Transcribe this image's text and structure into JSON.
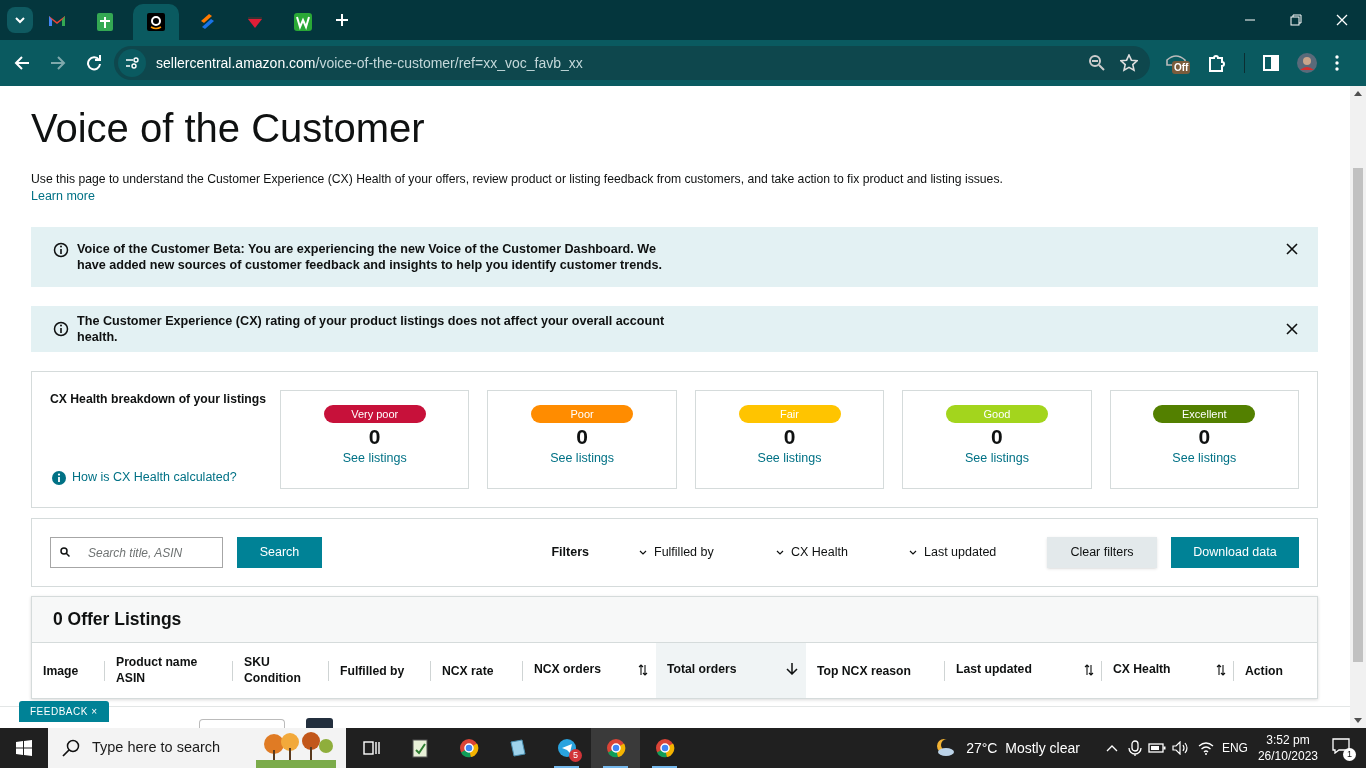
{
  "browser": {
    "tabs": [
      {
        "kind": "gmail",
        "selected": false
      },
      {
        "kind": "sheet",
        "selected": false
      },
      {
        "kind": "amazon",
        "selected": true
      },
      {
        "kind": "stripes",
        "selected": false
      },
      {
        "kind": "red",
        "selected": false
      },
      {
        "kind": "w",
        "selected": false
      }
    ],
    "address": {
      "host": "sellercentral.amazon.com",
      "path": "/voice-of-the-customer/ref=xx_voc_favb_xx"
    },
    "extension_badge": "Off"
  },
  "page": {
    "title": "Voice of the Customer",
    "description": "Use this page to understand the Customer Experience (CX) Health of your offers, review product or listing feedback from customers, and take action to fix product and listing issues.",
    "learn_more": "Learn more",
    "banners": [
      "Voice of the Customer Beta: You are experiencing the new Voice of the Customer Dashboard. We have added new sources of customer feedback and insights to help you identify customer trends.",
      "The Customer Experience (CX) rating of your product listings does not affect your overall account health."
    ],
    "cx_health": {
      "heading": "CX Health breakdown of your listings",
      "help_link": "How is CX Health calculated?",
      "cards": [
        {
          "label": "Very poor",
          "color": "#c7113a",
          "count": "0",
          "link": "See listings"
        },
        {
          "label": "Poor",
          "color": "#ff8c00",
          "count": "0",
          "link": "See listings"
        },
        {
          "label": "Fair",
          "color": "#ffc400",
          "count": "0",
          "link": "See listings"
        },
        {
          "label": "Good",
          "color": "#a3d51d",
          "count": "0",
          "link": "See listings"
        },
        {
          "label": "Excellent",
          "color": "#538000",
          "count": "0",
          "link": "See listings"
        }
      ]
    },
    "filters": {
      "search_placeholder": "Search title, ASIN",
      "search_button": "Search",
      "label": "Filters",
      "dropdowns": [
        "Fulfilled by",
        "CX Health",
        "Last updated"
      ],
      "clear_button": "Clear filters",
      "download_button": "Download data"
    },
    "listings": {
      "title": "0 Offer Listings",
      "columns": [
        {
          "lines": [
            "Image"
          ],
          "sortable": false,
          "sorted": false
        },
        {
          "lines": [
            "Product name",
            "ASIN"
          ],
          "sortable": false,
          "sorted": false
        },
        {
          "lines": [
            "SKU",
            "Condition"
          ],
          "sortable": false,
          "sorted": false
        },
        {
          "lines": [
            "Fulfilled by"
          ],
          "sortable": false,
          "sorted": false
        },
        {
          "lines": [
            "NCX rate"
          ],
          "sortable": false,
          "sorted": false
        },
        {
          "lines": [
            "NCX orders"
          ],
          "sortable": true,
          "sorted": false
        },
        {
          "lines": [
            "Total orders"
          ],
          "sortable": true,
          "sorted": true
        },
        {
          "lines": [
            "Top NCX reason"
          ],
          "sortable": false,
          "sorted": false
        },
        {
          "lines": [
            "Last updated"
          ],
          "sortable": true,
          "sorted": false
        },
        {
          "lines": [
            "CX Health"
          ],
          "sortable": true,
          "sorted": false
        },
        {
          "lines": [
            "Action"
          ],
          "sortable": false,
          "sorted": false
        }
      ]
    },
    "feedback_tab": "FEEDBACK ×"
  },
  "taskbar": {
    "search_placeholder": "Type here to search",
    "telegram_badge": "5",
    "weather": "27°C  Mostly clear",
    "language": "ENG",
    "time": "3:52 pm",
    "date": "26/10/2023",
    "notifications": "1"
  }
}
